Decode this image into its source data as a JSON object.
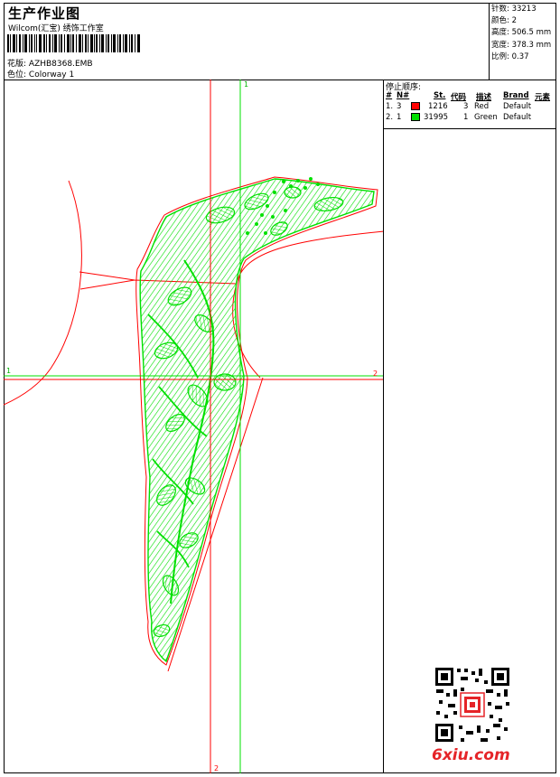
{
  "header": {
    "title": "生产作业图",
    "company": "Wilcom(汇宝) 绣饰工作室",
    "design_label": "花版:",
    "design_file": "AZHB8368.EMB",
    "colorway_label": "色位:",
    "colorway": "Colorway 1"
  },
  "stats": [
    {
      "label": "针数:",
      "value": "33213"
    },
    {
      "label": "颜色:",
      "value": "2"
    },
    {
      "label": "高度:",
      "value": "506.5 mm"
    },
    {
      "label": "宽度:",
      "value": "378.3 mm"
    },
    {
      "label": "比例:",
      "value": "0.37"
    }
  ],
  "stop_sequence": {
    "title": "停止顺序:",
    "columns": [
      "#",
      "N#",
      "St.",
      "代码",
      "描述",
      "Brand",
      "元素"
    ],
    "rows": [
      {
        "index": "1.",
        "n": "3",
        "color": "#ff0000",
        "stitches": "1216",
        "code": "3",
        "desc": "Red",
        "brand": "Default"
      },
      {
        "index": "2.",
        "n": "1",
        "color": "#00e000",
        "stitches": "31995",
        "code": "1",
        "desc": "Green",
        "brand": "Default"
      }
    ]
  },
  "axes": {
    "v1_top": "1",
    "v2_bottom": "2",
    "h1_left": "1",
    "h2_right": "2"
  },
  "watermark": "6xiu.com",
  "qr_badge": "QR-code-icon",
  "colors": {
    "stitch_green": "#00e000",
    "outline_red": "#ff0000",
    "text_red": "#e52428"
  }
}
